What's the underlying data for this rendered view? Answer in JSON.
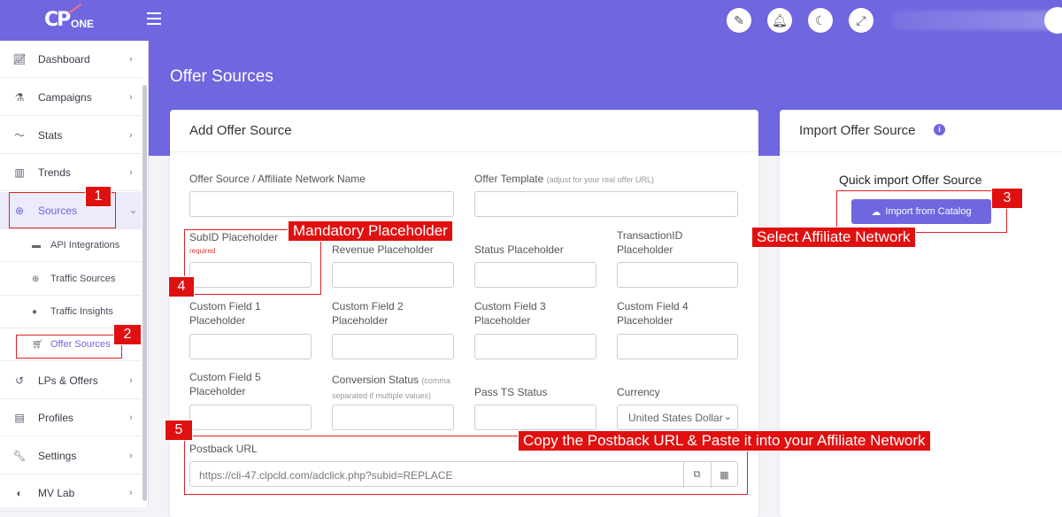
{
  "topbar": {
    "logo_cp": "CP",
    "logo_one": "ONE",
    "icons": [
      "magic-wand-icon",
      "bell-icon",
      "moon-icon",
      "expand-icon"
    ]
  },
  "sidebar": {
    "items": [
      {
        "label": "Dashboard",
        "icon": "chart-line-icon"
      },
      {
        "label": "Campaigns",
        "icon": "flask-icon"
      },
      {
        "label": "Stats",
        "icon": "stats-icon"
      },
      {
        "label": "Trends",
        "icon": "trends-icon"
      },
      {
        "label": "Sources",
        "icon": "globe-icon"
      },
      {
        "label": "LPs & Offers",
        "icon": "history-icon"
      },
      {
        "label": "Profiles",
        "icon": "clipboard-icon"
      },
      {
        "label": "Settings",
        "icon": "wrench-icon"
      },
      {
        "label": "MV Lab",
        "icon": "lab-icon"
      }
    ],
    "sub_items": [
      {
        "label": "API Integrations",
        "icon": "folder-icon"
      },
      {
        "label": "Traffic Sources",
        "icon": "globe-icon"
      },
      {
        "label": "Traffic Insights",
        "icon": "globe-icon"
      },
      {
        "label": "Offer Sources",
        "icon": "cart-icon"
      }
    ]
  },
  "page": {
    "title": "Offer Sources"
  },
  "add_card": {
    "title": "Add Offer Source",
    "fields": {
      "name_label": "Offer Source / Affiliate Network Name",
      "template_label": "Offer Template",
      "template_hint": "(adjust for your real offer URL)",
      "subid_label": "SubID Placeholder",
      "subid_required": "required",
      "revenue_label": "Revenue Placeholder",
      "status_label": "Status Placeholder",
      "transaction_label_1": "TransactionID",
      "transaction_label_2": "Placeholder",
      "cf1_label_1": "Custom Field 1",
      "cf1_label_2": "Placeholder",
      "cf2_label_1": "Custom Field 2",
      "cf2_label_2": "Placeholder",
      "cf3_label_1": "Custom Field 3",
      "cf3_label_2": "Placeholder",
      "cf4_label_1": "Custom Field 4",
      "cf4_label_2": "Placeholder",
      "cf5_label_1": "Custom Field 5",
      "cf5_label_2": "Placeholder",
      "conversion_label": "Conversion Status",
      "conversion_hint_1": "(comma",
      "conversion_hint_2": "separated if multiple values)",
      "pass_ts_label": "Pass TS Status",
      "currency_label": "Currency",
      "currency_value": "United States Dollar",
      "postback_label": "Postback URL",
      "postback_value": "https://cli-47.clpcld.com/adclick.php?subid=REPLACE"
    }
  },
  "import_card": {
    "title": "Import Offer Source",
    "quick_title": "Quick import Offer Source",
    "button_label": "Import from Catalog"
  },
  "annotations": {
    "badge_1": "1",
    "badge_2": "2",
    "badge_3": "3",
    "badge_4": "4",
    "badge_5": "5",
    "callout_mandatory": "Mandatory Placeholder",
    "callout_select": "Select Affiliate Network",
    "callout_postback": "Copy the Postback URL & Paste it into your Affiliate Network"
  },
  "colors": {
    "accent": "#7066e0",
    "annotation": "#e01010"
  }
}
